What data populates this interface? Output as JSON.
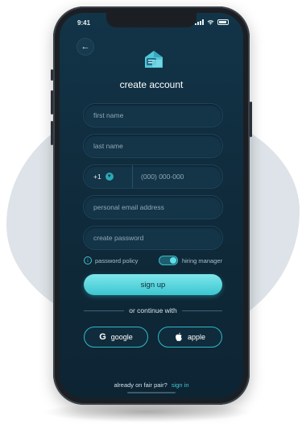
{
  "status": {
    "time": "9:41"
  },
  "header": {
    "title": "create account"
  },
  "form": {
    "first_name": {
      "placeholder": "first name"
    },
    "last_name": {
      "placeholder": "last name"
    },
    "phone": {
      "country_code": "+1",
      "placeholder": "(000) 000-000"
    },
    "email": {
      "placeholder": "personal email address"
    },
    "password": {
      "placeholder": "create password"
    }
  },
  "options": {
    "policy_label": "password policy",
    "hiring_label": "hiring manager",
    "hiring_enabled": true
  },
  "signup_label": "sign up",
  "divider_text": "or continue with",
  "social": {
    "google": "google",
    "apple": "apple"
  },
  "footer": {
    "prompt": "already on fair pair?",
    "link": "sign in"
  },
  "colors": {
    "accent": "#45c3cf",
    "screen_bg": "#123448",
    "button": "#5fd6de"
  }
}
